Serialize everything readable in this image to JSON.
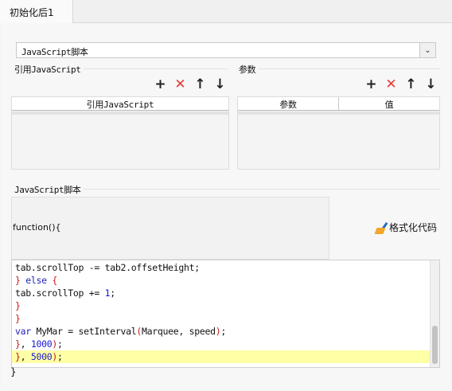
{
  "tab": {
    "title": "初始化后1"
  },
  "type_select": {
    "value": "JavaScript脚本"
  },
  "references": {
    "group_label": "引用JavaScript",
    "columns": [
      "引用JavaScript"
    ]
  },
  "params": {
    "group_label": "参数",
    "columns": [
      "参数",
      "值"
    ]
  },
  "script": {
    "group_label": "JavaScript脚本",
    "function_header": "function(){",
    "format_button": "格式化代码",
    "closing": "}"
  },
  "code_lines": [
    "tab.scrollTop -= tab2.offsetHeight;",
    "} else {",
    "tab.scrollTop += 1;",
    "}",
    "}",
    "var MyMar = setInterval(Marquee, speed);",
    "}, 1000);",
    "}, 5000);"
  ],
  "icons": {
    "add": "plus-icon",
    "delete": "delete-x-icon",
    "up": "arrow-up-icon",
    "down": "arrow-down-icon"
  },
  "colors": {
    "delete": "#e53935",
    "highlight_line": "#ffffa6",
    "keyword": "#2020b8",
    "bracket": "#c41a16"
  }
}
